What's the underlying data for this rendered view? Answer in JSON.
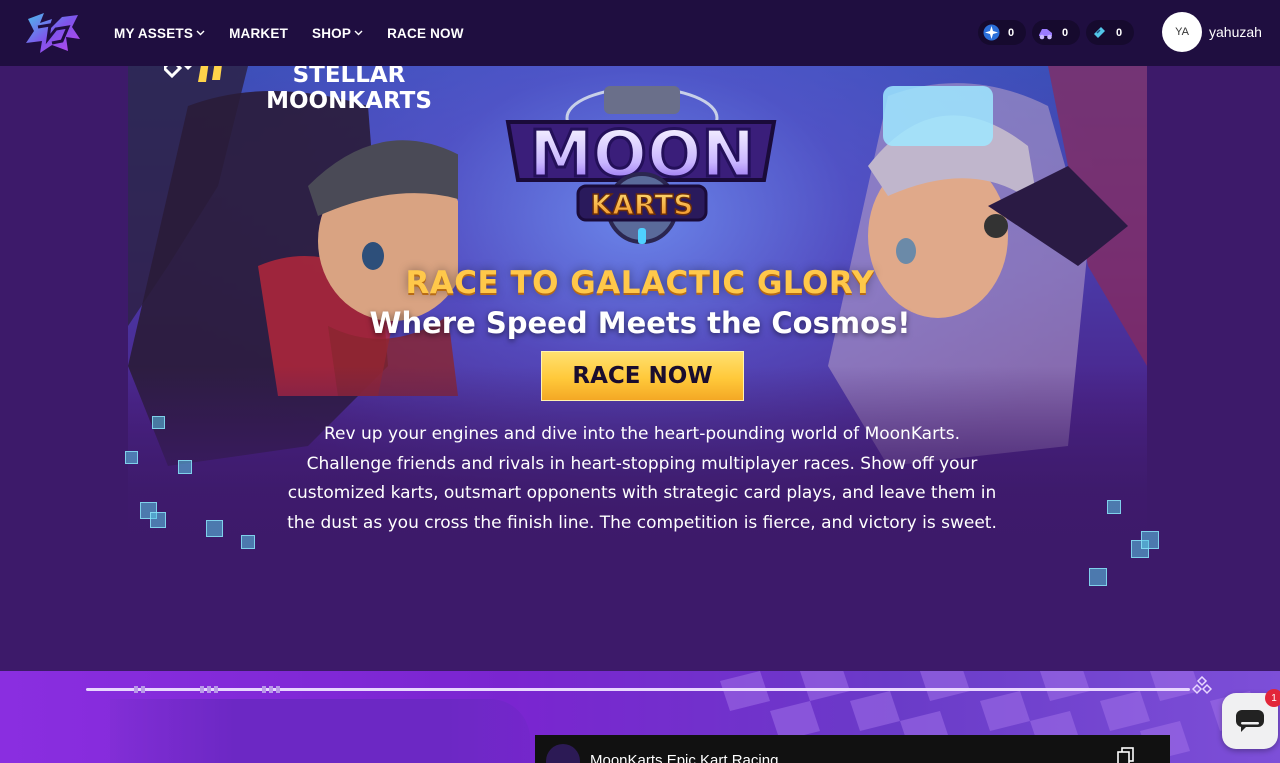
{
  "nav": {
    "items": [
      {
        "label": "MY ASSETS",
        "dropdown": true
      },
      {
        "label": "MARKET",
        "dropdown": false
      },
      {
        "label": "SHOP",
        "dropdown": true
      },
      {
        "label": "RACE NOW",
        "dropdown": false
      }
    ],
    "currencies": [
      {
        "icon": "star-token-icon",
        "value": "0"
      },
      {
        "icon": "kart-token-icon",
        "value": "0"
      },
      {
        "icon": "ticket-icon",
        "value": "0"
      }
    ],
    "user": {
      "initials": "YA",
      "name": "yahuzah"
    }
  },
  "hero": {
    "logo_text_top": "MOON",
    "logo_text_bottom": "KARTS",
    "tagline": "RACE TO GALACTIC GLORY",
    "subtagline": "Where Speed Meets the Cosmos!",
    "cta_label": "RACE NOW",
    "description": "Rev up your engines and dive into the heart-pounding world of MoonKarts. Challenge friends and rivals in heart-stopping multiplayer races. Show off your customized karts, outsmart opponents with strategic card plays, and leave them in the dust as you cross the finish line. The competition is fierce, and victory is sweet."
  },
  "create": {
    "title_line1": "CREATE STELLAR",
    "title_line2": "MOONKARTS"
  },
  "video": {
    "title": "MoonKarts Epic Kart Racing"
  },
  "chat": {
    "badge": "1"
  },
  "colors": {
    "nav_bg": "#1f0e40",
    "page_bg": "#3a1766",
    "cta": "#ffc93a",
    "tagline": "#ffc84a",
    "section_purple": "#7a25d0"
  }
}
